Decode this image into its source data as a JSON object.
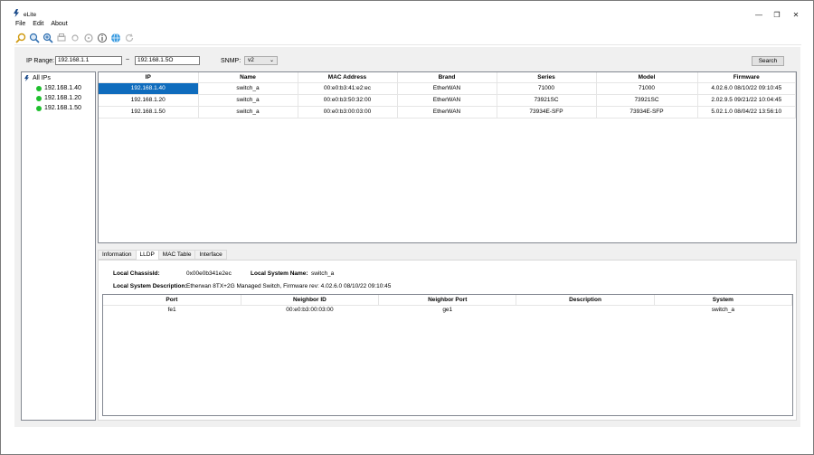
{
  "window": {
    "title": "eLite",
    "minimize": "—",
    "restore": "❐",
    "close": "✕"
  },
  "menu": [
    "File",
    "Edit",
    "About"
  ],
  "toolbar": [
    "search-icon",
    "zoom-icon",
    "zoom-in-icon",
    "print-icon",
    "sync-icon",
    "disk-icon",
    "info-icon",
    "globe-icon",
    "refresh-icon"
  ],
  "search": {
    "ip_range_label": "IP Range:",
    "ip_start": "192.168.1.1",
    "tilde": "~",
    "ip_end": "192.168.1.5O",
    "snmp_label": "SNMP:",
    "snmp_value": "v2",
    "search_button": "Search"
  },
  "tree": {
    "root": "All IPs",
    "items": [
      "192.168.1.40",
      "192.168.1.20",
      "192.168.1.50"
    ]
  },
  "devices": {
    "columns": [
      "IP",
      "Name",
      "MAC Address",
      "Brand",
      "Series",
      "Model",
      "Firmware"
    ],
    "rows": [
      [
        "192.168.1.40",
        "switch_a",
        "00:e0:b3:41:e2:ec",
        "EtherWAN",
        "71000",
        "71000",
        "4.02.6.0 08/10/22 09:10:45"
      ],
      [
        "192.168.1.20",
        "switch_a",
        "00:e0:b3:50:32:00",
        "EtherWAN",
        "73921SC",
        "73921SC",
        "2.02.9.5 09/21/22 10:04:45"
      ],
      [
        "192.168.1.50",
        "switch_a",
        "00:e0:b3:00:03:00",
        "EtherWAN",
        "73934E-SFP",
        "73934E-SFP",
        "5.02.1.0 08/04/22 13:56:10"
      ]
    ]
  },
  "tabs": [
    "Information",
    "LLDP",
    "MAC Table",
    "Interface"
  ],
  "lldp": {
    "chassis_label": "Local ChassisId:",
    "chassis_value": "0x00e0b341e2ec",
    "sysname_label": "Local System Name:",
    "sysname_value": "switch_a",
    "sysdesc_label": "Local System Description:",
    "sysdesc_value": "Etherwan 8TX+2G Managed Switch, Firmware rev: 4.02.6.0 08/10/22 09:10:45",
    "columns": [
      "Port",
      "Neighbor ID",
      "Neighbor Port",
      "Description",
      "System"
    ],
    "rows": [
      [
        "fe1",
        "00:e0:b3:00:03:00",
        "ge1",
        "",
        "switch_a"
      ]
    ]
  },
  "colors": {
    "selection": "#0f6cbd",
    "status_online": "#1fbf2e"
  }
}
